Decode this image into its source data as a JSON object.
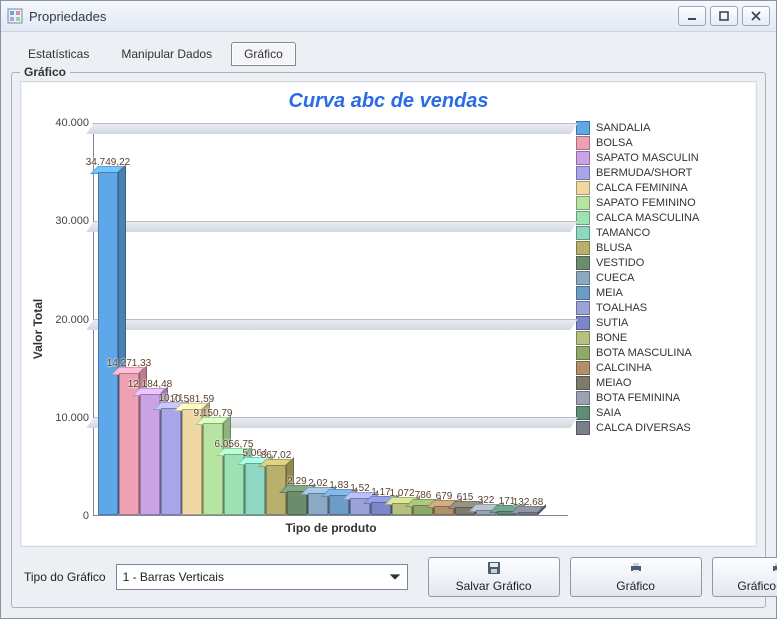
{
  "window": {
    "title": "Propriedades"
  },
  "tabs": {
    "items": [
      "Estatísticas",
      "Manipular Dados",
      "Gráfico"
    ],
    "active": 2
  },
  "groupbox": {
    "caption": "Gráfico"
  },
  "bottom": {
    "type_label": "Tipo do Gráfico",
    "combo_value": "1 - Barras Verticais",
    "save_label": "Salvar Gráfico",
    "print_chart_label": "Gráfico",
    "print_both_label": "Gráfico+Dados"
  },
  "chart_data": {
    "type": "bar",
    "title": "Curva abc de vendas",
    "xlabel": "Tipo de produto",
    "ylabel": "Valor Total",
    "ylim": [
      0,
      40000
    ],
    "yticks": [
      0,
      10000,
      20000,
      30000,
      40000
    ],
    "ytick_labels": [
      "0",
      "10.000",
      "20.000",
      "30.000",
      "40.000"
    ],
    "series": [
      {
        "name": "SANDALIA",
        "value": 34749.22,
        "label": "34.749,22",
        "color": "#5FA7E8"
      },
      {
        "name": "BOLSA",
        "value": 14271.33,
        "label": "14.271,33",
        "color": "#EFA1B4"
      },
      {
        "name": "SAPATO MASCULIN",
        "value": 12184.48,
        "label": "12.184,48",
        "color": "#C9A3E6"
      },
      {
        "name": "BERMUDA/SHORT",
        "value": 10710.0,
        "label": "10.71",
        "color": "#A8A6E8"
      },
      {
        "name": "CALCA FEMININA",
        "value": 10581.59,
        "label": "10.581,59",
        "color": "#F0D8A3"
      },
      {
        "name": "SAPATO FEMININO",
        "value": 9150.79,
        "label": "9.150,79",
        "color": "#B6E5A1"
      },
      {
        "name": "CALCA MASCULINA",
        "value": 6056.75,
        "label": "6.056,75",
        "color": "#9DE2B2"
      },
      {
        "name": "TAMANCO",
        "value": 5064.0,
        "label": "5.064",
        "color": "#8ED7C2"
      },
      {
        "name": "BLUSA",
        "value": 4867.02,
        "label": "867,02",
        "color": "#B9B06B"
      },
      {
        "name": "VESTIDO",
        "value": 2290.0,
        "label": "2.29",
        "color": "#6C8C6E"
      },
      {
        "name": "CUECA",
        "value": 2020.0,
        "label": "2.02",
        "color": "#8AA9C2"
      },
      {
        "name": "MEIA",
        "value": 1830.0,
        "label": "1.83",
        "color": "#6C9BC6"
      },
      {
        "name": "TOALHAS",
        "value": 1520.0,
        "label": "1.52",
        "color": "#9AA2D6"
      },
      {
        "name": "SUTIA",
        "value": 1170.0,
        "label": "1.17",
        "color": "#7D86C6"
      },
      {
        "name": "BONE",
        "value": 1072.0,
        "label": "1.072",
        "color": "#B7C17E"
      },
      {
        "name": "BOTA MASCULINA",
        "value": 786.0,
        "label": "786",
        "color": "#8FA96A"
      },
      {
        "name": "CALCINHA",
        "value": 679.0,
        "label": "679",
        "color": "#B2906A"
      },
      {
        "name": "MEIAO",
        "value": 615.0,
        "label": "615",
        "color": "#7E7A6C"
      },
      {
        "name": "BOTA FEMININA",
        "value": 322.0,
        "label": "322",
        "color": "#9AA3B2"
      },
      {
        "name": "SAIA",
        "value": 171.0,
        "label": "171",
        "color": "#5E8E78"
      },
      {
        "name": "CALCA DIVERSAS",
        "value": 132.68,
        "label": "132,68",
        "color": "#7A7F8C"
      }
    ]
  }
}
